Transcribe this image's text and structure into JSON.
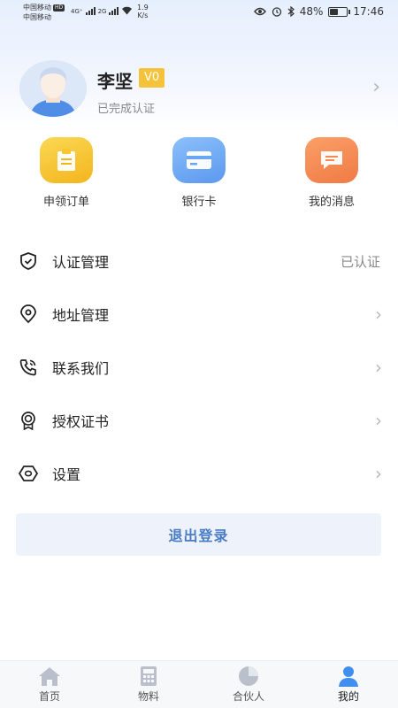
{
  "status_bar": {
    "carrier1": "中国移动",
    "carrier2": "中国移动",
    "hd": "HD",
    "net1": "4G⁺",
    "net2": "2G",
    "speed_value": "1.9",
    "speed_unit": "K/s",
    "battery": "48%",
    "battery_level": 0.48,
    "time": "17:46"
  },
  "profile": {
    "name": "李坚",
    "level": "V0",
    "auth_status": "已完成认证"
  },
  "quick_actions": [
    {
      "label": "申领订单",
      "color": "#f6c12f",
      "icon": "clipboard-icon"
    },
    {
      "label": "银行卡",
      "color": "#6aa7f3",
      "icon": "bank-card-icon"
    },
    {
      "label": "我的消息",
      "color": "#f58a57",
      "icon": "message-icon"
    }
  ],
  "menu": [
    {
      "label": "认证管理",
      "right_text": "已认证",
      "icon": "shield-check-icon"
    },
    {
      "label": "地址管理",
      "icon": "location-pin-icon"
    },
    {
      "label": "联系我们",
      "icon": "phone-call-icon"
    },
    {
      "label": "授权证书",
      "icon": "certificate-icon"
    },
    {
      "label": "设置",
      "icon": "settings-hex-icon"
    }
  ],
  "logout_label": "退出登录",
  "bottom_nav": [
    {
      "label": "首页",
      "icon": "home-icon"
    },
    {
      "label": "物料",
      "icon": "calculator-icon"
    },
    {
      "label": "合伙人",
      "icon": "pie-chart-icon"
    },
    {
      "label": "我的",
      "icon": "user-icon",
      "active": true
    }
  ],
  "colors": {
    "accent": "#4a7cc6",
    "nav_icon": "#b9c0cc",
    "nav_active": "#3f8ef0"
  }
}
